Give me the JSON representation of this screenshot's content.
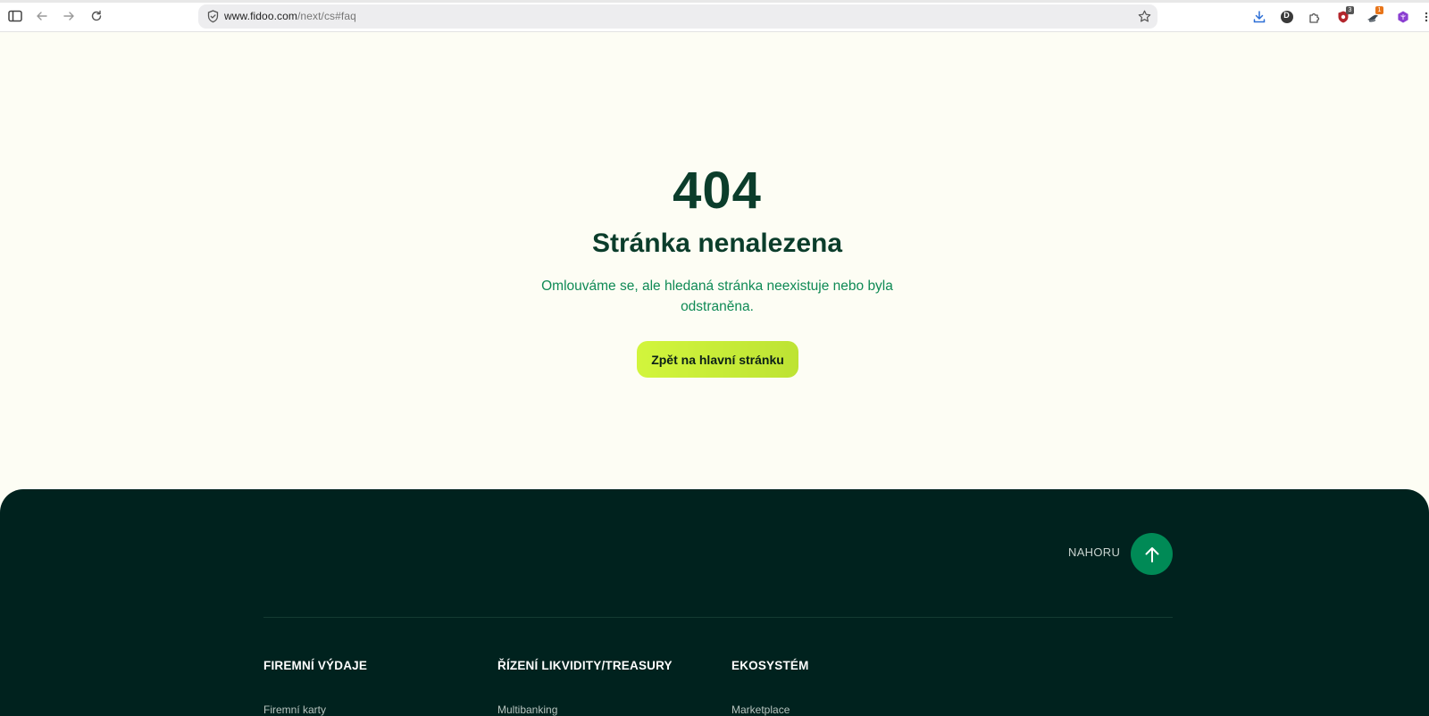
{
  "browser": {
    "url_host": "www.fidoo.com",
    "url_path": "/next/cs#faq",
    "extensions": [
      {
        "name": "download-icon"
      },
      {
        "name": "profile-d-icon",
        "label": "D"
      },
      {
        "name": "puzzle-extension-icon"
      },
      {
        "name": "shield-extension-icon",
        "badge": "3"
      },
      {
        "name": "bird-extension-icon",
        "badge": "1"
      },
      {
        "name": "purple-hex-extension-icon"
      }
    ]
  },
  "error": {
    "code": "404",
    "title": "Stránka nenalezena",
    "description": "Omlouváme se, ale hledaná stránka neexistuje nebo byla odstraněna.",
    "cta_label": "Zpět na hlavní stránku"
  },
  "footer": {
    "back_to_top_label": "NAHORU",
    "columns": [
      {
        "heading": "FIREMNÍ VÝDAJE",
        "first_link": "Firemní karty"
      },
      {
        "heading": "ŘÍZENÍ LIKVIDITY/TREASURY",
        "first_link": "Multibanking"
      },
      {
        "heading": "EKOSYSTÉM",
        "first_link": "Marketplace"
      }
    ]
  },
  "colors": {
    "page_bg": "#fdfdf4",
    "heading": "#0b3d2b",
    "accent_green": "#0f8a55",
    "cta_lime": "#cbef38",
    "footer_bg": "#00221e",
    "back_to_top_bg": "#008a56"
  }
}
